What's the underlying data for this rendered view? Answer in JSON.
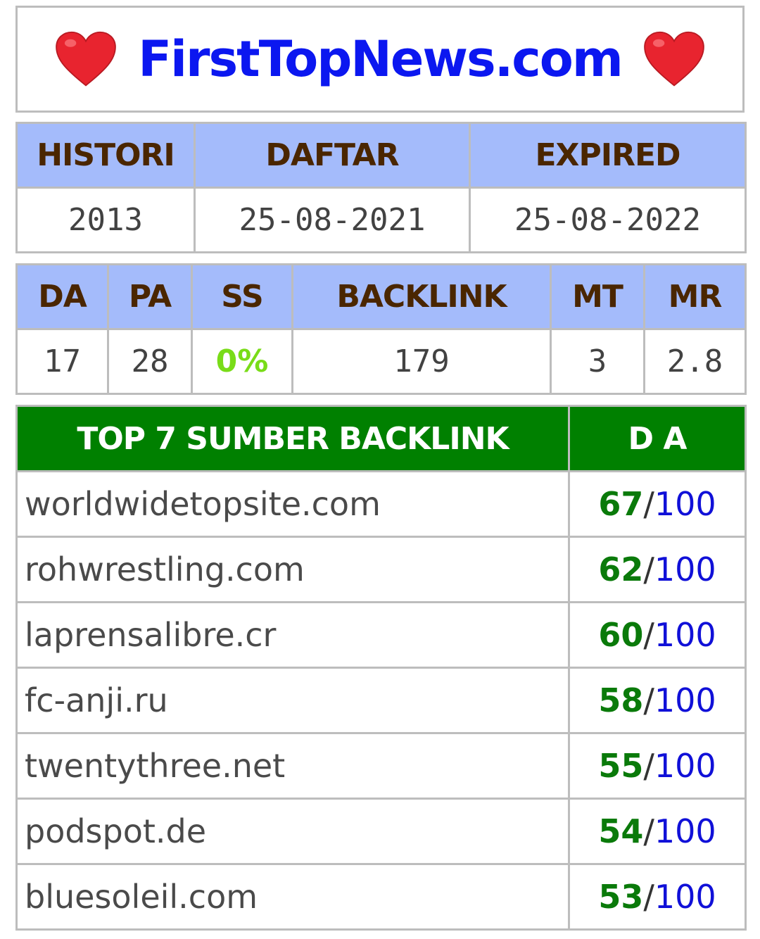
{
  "header": {
    "site_name": "FirstTopNews.com",
    "heart_color": "#e8242f"
  },
  "info": {
    "headers": [
      "HISTORI",
      "DAFTAR",
      "EXPIRED"
    ],
    "values": [
      "2013",
      "25-08-2021",
      "25-08-2022"
    ]
  },
  "stats": {
    "headers": [
      "DA",
      "PA",
      "SS",
      "BACKLINK",
      "MT",
      "MR"
    ],
    "values": [
      "17",
      "28",
      "0%",
      "179",
      "3",
      "2.8"
    ]
  },
  "backlinks": {
    "header_source": "TOP 7 SUMBER BACKLINK",
    "header_da": "D A",
    "separator": "/",
    "max": "100",
    "rows": [
      {
        "domain": "worldwidetopsite.com",
        "da": "67"
      },
      {
        "domain": "rohwrestling.com",
        "da": "62"
      },
      {
        "domain": "laprensalibre.cr",
        "da": "60"
      },
      {
        "domain": "fc-anji.ru",
        "da": "58"
      },
      {
        "domain": "twentythree.net",
        "da": "55"
      },
      {
        "domain": "podspot.de",
        "da": "54"
      },
      {
        "domain": "bluesoleil.com",
        "da": "53"
      }
    ]
  },
  "colors": {
    "header_blue_bg": "#a4bbfb",
    "header_blue_text": "#4a2600",
    "header_green_bg": "#008000",
    "title_blue": "#0b17f0",
    "ss_green": "#79dc18",
    "da_green": "#0a7a0a",
    "max_blue": "#1010d8"
  }
}
